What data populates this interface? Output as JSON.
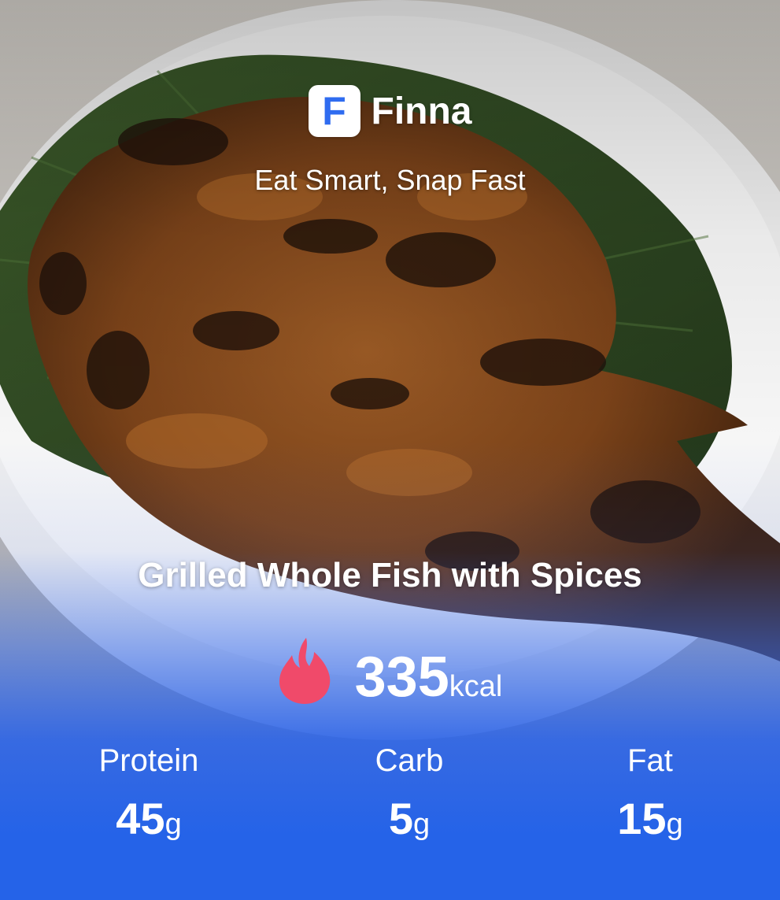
{
  "brand": {
    "logo_letter": "F",
    "name": "Finna",
    "tagline": "Eat Smart, Snap Fast"
  },
  "dish": {
    "name": "Grilled Whole Fish with Spices"
  },
  "calories": {
    "value": "335",
    "unit": "kcal",
    "icon": "flame-icon"
  },
  "macros": [
    {
      "label": "Protein",
      "value": "45",
      "unit": "g"
    },
    {
      "label": "Carb",
      "value": "5",
      "unit": "g"
    },
    {
      "label": "Fat",
      "value": "15",
      "unit": "g"
    }
  ],
  "colors": {
    "accent_blue": "#2563e8",
    "logo_blue": "#2f6cf0",
    "flame": "#f04a6a",
    "text": "#ffffff"
  }
}
